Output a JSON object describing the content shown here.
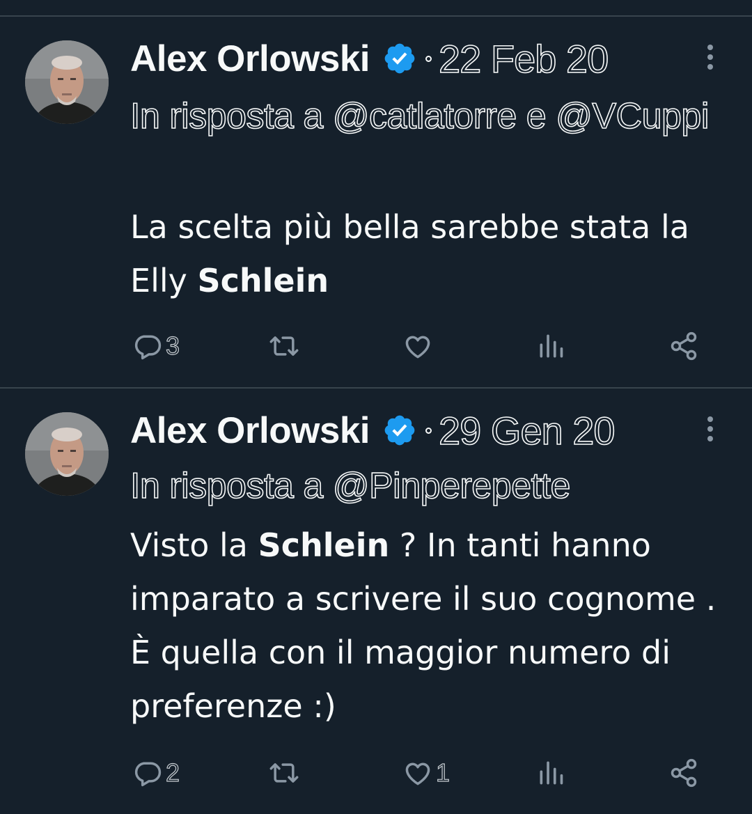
{
  "tweets": [
    {
      "author": "Alex Orlowski",
      "date": "22 Feb 20",
      "reply_to": "In risposta a @catlatorre e @VCuppi",
      "text_before": "La scelta più bella sarebbe stata la Elly ",
      "text_bold": "Schlein",
      "text_after": "",
      "reply_count": "3",
      "retweet_count": "",
      "like_count": ""
    },
    {
      "author": "Alex Orlowski",
      "date": "29 Gen 20",
      "reply_to": "In risposta a @Pinperepette",
      "text_before": "Visto la ",
      "text_bold": "Schlein",
      "text_after": " ? In tanti hanno imparato a scrivere il suo cognome . È quella con il maggior numero di preferenze :)",
      "reply_count": "2",
      "retweet_count": "",
      "like_count": "1"
    }
  ],
  "colors": {
    "background": "#15202b",
    "divider": "#38444d",
    "text": "#f7f9f9",
    "icon": "#8b98a5",
    "verified": "#1d9bf0"
  },
  "icons": [
    "verified-badge-icon",
    "more-icon",
    "reply-icon",
    "retweet-icon",
    "like-icon",
    "views-icon",
    "share-icon"
  ]
}
